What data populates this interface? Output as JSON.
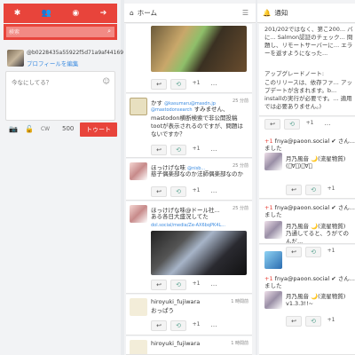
{
  "nav": {
    "icons": [
      "snowflake-icon",
      "users-icon",
      "globe-icon",
      "logout-icon"
    ],
    "search_placeholder": "検索"
  },
  "account": {
    "name": "@b0228435a55922f5d71a9af44169",
    "edit_profile": "プロフィールを編集"
  },
  "compose": {
    "placeholder": "今なにしてる？",
    "cw_label": "CW",
    "char_count": "500",
    "toot_label": "トゥート"
  },
  "home": {
    "title": "ホーム",
    "posts": [
      {
        "name": "かす",
        "handle": "@kasumaru@masdn.jp",
        "time": "25 分前",
        "mention": "@mastodonsearch",
        "text": "すみません、mastodon横断検索で非公開投稿tootが表示されるのですが、問題はないですか？",
        "plus": "+1"
      },
      {
        "name": "ほっけげな味",
        "handle": "@nisb...",
        "time": "25 分前",
        "text": "慈子偶楽部なのか法師偶楽部なのか",
        "plus": "+1"
      },
      {
        "name": "ほっけげな味@ドール社...",
        "handle": "",
        "time": "25 分前",
        "text": "ある各日大盛況してた",
        "link": "dol.social/media/Ze-AX6bqPK4L...",
        "plus": "+1"
      },
      {
        "name": "hiroyuki_fujiwara",
        "handle": "",
        "time": "1 時間前",
        "text": "おっぱう",
        "plus": "+1"
      },
      {
        "name": "hiroyuki_fujiwara",
        "handle": "",
        "time": "1 時間前",
        "text": "",
        "plus": "+1"
      }
    ],
    "top_plus": "+1"
  },
  "notifications": {
    "title": "通知",
    "top_text": "201/202ではなく、第こ200... バに... Salmon認証のチェック... 問題し、リモートサーバーに... エラーを返すようになった...",
    "release_title": "アップグレードノート:",
    "release_text": "このリリースは、依存ファ... アップデートが含まれます。b... installの実行が必要です。... 適用では必要ありません。)",
    "items": [
      {
        "plus": "+1",
        "user": "fnya@paoon.social",
        "verb": "さん...",
        "text": "ました",
        "sub_user": "月乃風音 🌙(流星物質)",
        "sub_text": "(ﾟ∀ﾟ)ﾟ∀ﾟ"
      },
      {
        "plus": "+1",
        "user": "fnya@paoon.social",
        "verb": "さん...",
        "text": "ました",
        "sub_user": "月乃風音 🌙(流星物質)",
        "sub_text": "乃通してると、うがてのんだ..."
      },
      {
        "plus": "+1",
        "user": "fnya@paoon.social",
        "verb": "さん...",
        "text": "ました",
        "sub_user": "月乃風音 🌙(流星物質)",
        "sub_text": "v1.3.3!!~"
      }
    ],
    "plus_labels": [
      "+1",
      "+1",
      "+1",
      "+1"
    ]
  }
}
